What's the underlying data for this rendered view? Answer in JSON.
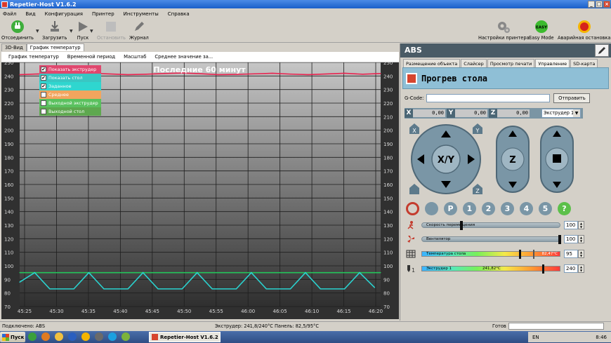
{
  "window": {
    "title": "Repetier-Host V1.6.2",
    "buttons": [
      "_",
      "□",
      "×"
    ]
  },
  "menu": [
    "Файл",
    "Вид",
    "Конфигурация",
    "Принтер",
    "Инструменты",
    "Справка"
  ],
  "toolbar": {
    "disconnect": "Отсоединить",
    "load": "Загрузить",
    "run": "Пуск",
    "stop": "Остановить",
    "log": "Журнал",
    "printer_settings": "Настройки принтера",
    "easy_mode": "Easy Mode",
    "easy_badge": "EASY",
    "emergency": "Аварийная остановка"
  },
  "left_tabs": [
    "3D-Вид",
    "График температур"
  ],
  "sub_tabs": [
    "График температур",
    "Временной период",
    "Масштаб",
    "Среднее значение за..."
  ],
  "right": {
    "header": "ABS",
    "tabs": [
      "Размещение объекта",
      "Слайсер",
      "Просмотр печати",
      "Управление",
      "SD-карта"
    ],
    "heat_title": "Прогрев стола",
    "gcode_label": "G-Code:",
    "gcode_value": "",
    "send": "Отправить",
    "coords": {
      "x_label": "X",
      "x": "0,00",
      "y_label": "Y",
      "y": "0,00",
      "z_label": "Z",
      "z": "0,00"
    },
    "extruder_select": "Экструдер 1",
    "move_labels": {
      "xy": "X/Y",
      "z": "Z",
      "home": "⌂",
      "x_home": "X",
      "y_home": "Y",
      "z_home": "Z"
    },
    "buttons_row": [
      "1",
      "2",
      "3",
      "4",
      "5",
      "?"
    ],
    "p_label": "P",
    "speed": {
      "label": "Скорость перемещения",
      "value": "100"
    },
    "fan": {
      "label": "Вентилятор",
      "value": "100"
    },
    "bed": {
      "label": "Температура стола",
      "reading": "82,47°C",
      "value": "95"
    },
    "extruder": {
      "label": "Экструдер 1",
      "reading": "241,82°C",
      "value": "240",
      "index": "1"
    }
  },
  "chart_data": {
    "type": "line",
    "title": "Последние 60 минут",
    "x_ticks": [
      "45:25",
      "45:30",
      "45:35",
      "45:40",
      "45:45",
      "45:50",
      "45:55",
      "46:00",
      "46:05",
      "46:10",
      "46:15",
      "46:20"
    ],
    "y_ticks": [
      70,
      80,
      90,
      100,
      110,
      120,
      130,
      140,
      150,
      160,
      170,
      180,
      190,
      200,
      210,
      220,
      230,
      240,
      250
    ],
    "ylim": [
      70,
      250
    ],
    "grid": true,
    "legend": [
      {
        "label": "Показать экструдер",
        "checked": true,
        "color": "#e0476e"
      },
      {
        "label": "Показать стол",
        "checked": true,
        "color": "#39c7c3"
      },
      {
        "label": "Заданное",
        "checked": true,
        "color": "#2fd6cf"
      },
      {
        "label": "Среднее",
        "checked": false,
        "color": "#f2a55e"
      },
      {
        "label": "Выходной экструдер",
        "checked": false,
        "color": "#59c15e"
      },
      {
        "label": "Выходной стол",
        "checked": false,
        "color": "#5ea84f"
      }
    ],
    "series": [
      {
        "name": "Показать экструдер",
        "color": "#e8234f",
        "x": [
          0,
          3,
          6,
          9,
          12,
          15,
          18,
          21,
          24,
          27,
          30,
          33,
          36,
          39,
          42,
          45,
          48,
          51,
          54,
          57,
          60
        ],
        "values": [
          241,
          241.5,
          241.2,
          241.8,
          242,
          241.5,
          241,
          241.3,
          241.8,
          242.2,
          241.7,
          241,
          241.2,
          241.6,
          242,
          241.4,
          241,
          241.5,
          242,
          241.3,
          241.8
        ]
      },
      {
        "name": "Заданное стола",
        "color": "#23c45a",
        "x": [
          0,
          60
        ],
        "values": [
          95,
          95
        ]
      },
      {
        "name": "Показать стол",
        "color": "#2ad3d0",
        "x": [
          0,
          2.5,
          5,
          9,
          11.5,
          14,
          18,
          20.5,
          23,
          27,
          29.5,
          32,
          36,
          38.5,
          41,
          45,
          47.5,
          50,
          54,
          56.5,
          59
        ],
        "values": [
          88,
          95,
          83,
          83,
          95,
          83,
          83,
          95,
          83,
          83,
          95,
          83,
          83,
          95,
          83,
          83,
          95,
          83,
          83,
          95,
          84
        ]
      }
    ]
  },
  "status": {
    "connected": "Подключено: ABS",
    "temps": "Экструдер: 241,8/240°C Панель: 82,5/95°C",
    "ready": "Готов"
  },
  "taskbar": {
    "start": "Пуск",
    "app": "Repetier-Host V1.6.2",
    "lang": "EN",
    "time": "8:46"
  }
}
